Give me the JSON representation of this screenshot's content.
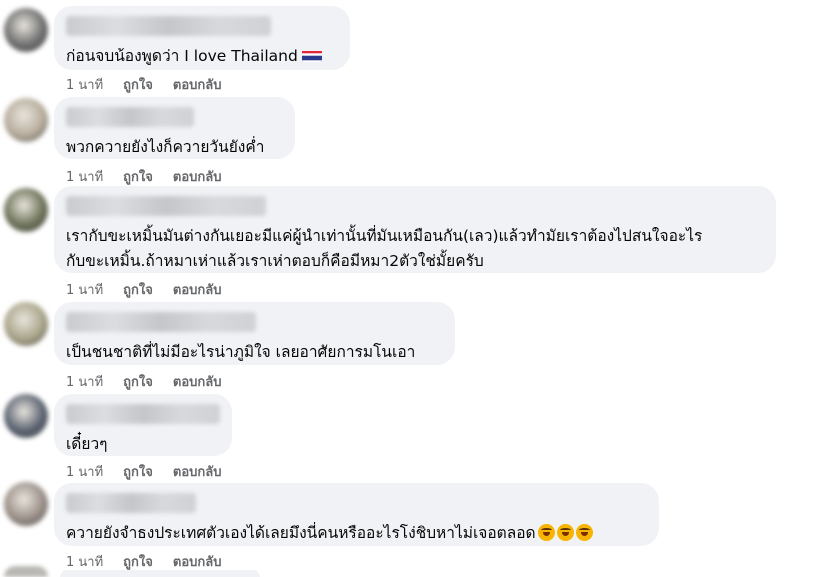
{
  "comments": [
    {
      "text": "ก่อนจบน้องพูดว่า I love Thailand",
      "flag": "thailand-flag",
      "time": "1 นาที",
      "like": "ถูกใจ",
      "reply": "ตอบกลับ",
      "avatar_color": "#6f6f6f"
    },
    {
      "text": "พวกควายยังไงก็ควายวันยังค่ำ",
      "time": "1 นาที",
      "like": "ถูกใจ",
      "reply": "ตอบกลับ",
      "avatar_color": "#b7ad9c"
    },
    {
      "text": "เรากับขะเหมิ้นมันต่างกันเยอะมีแค่ผู้นำเท่านั้นที่มันเหมือนกัน(เลว)แล้วทำมัยเราต้องไปสนใจอะไร\nกับขะเหมิ้น.ถ้าหมาเห่าแล้วเราเห่าตอบก็คือมีหมา2ตัวใช่มั้ยครับ",
      "time": "1 นาที",
      "like": "ถูกใจ",
      "reply": "ตอบกลับ",
      "avatar_color": "#6d7358"
    },
    {
      "text": "เป็นชนชาติที่ไม่มีอะไรน่าภูมิใจ เลยอาศัยการมโนเอา",
      "time": "1 นาที",
      "like": "ถูกใจ",
      "reply": "ตอบกลับ",
      "avatar_color": "#a9a489"
    },
    {
      "text": "เดี๋ยวๆ",
      "time": "1 นาที",
      "like": "ถูกใจ",
      "reply": "ตอบกลับ",
      "avatar_color": "#5a6270"
    },
    {
      "text": "ควายยังจำธงประเทศตัวเองได้เลยมึงนี่คนหรืออะไรโง่ชิบหาไม่เจอตลอด",
      "emoji": "rofl-emoji",
      "time": "1 นาที",
      "like": "ถูกใจ",
      "reply": "ตอบกลับ",
      "avatar_color": "#9a8f88"
    }
  ]
}
